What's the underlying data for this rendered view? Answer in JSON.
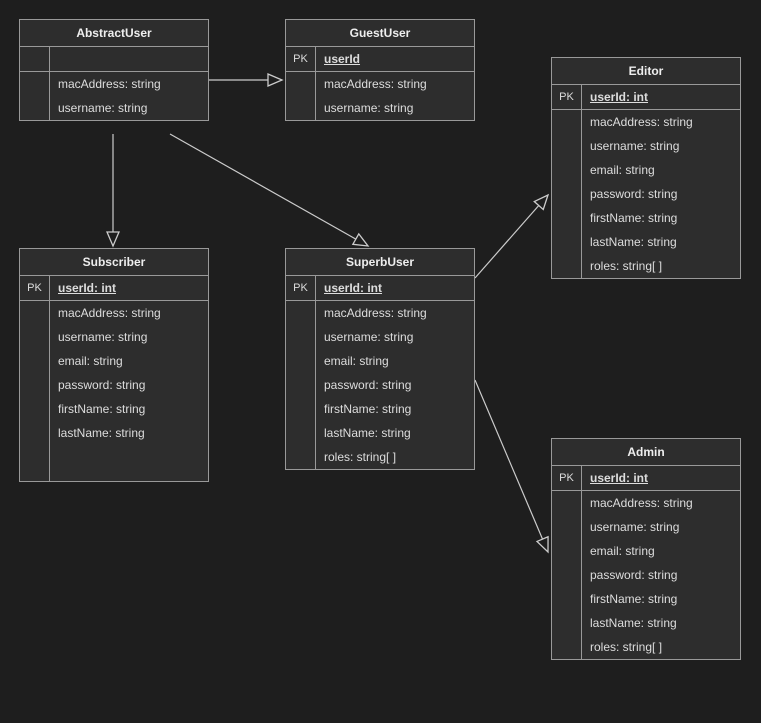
{
  "pk_label": "PK",
  "classes": {
    "abstractUser": {
      "title": "AbstractUser",
      "key": null,
      "attributes": [
        "macAddress: string",
        "username: string"
      ]
    },
    "guestUser": {
      "title": "GuestUser",
      "pk": "PK",
      "key": "userId",
      "attributes": [
        "macAddress: string",
        "username: string"
      ]
    },
    "subscriber": {
      "title": "Subscriber",
      "pk": "PK",
      "key": "userId: int",
      "attributes": [
        "macAddress: string",
        "username: string",
        "email: string",
        "password: string",
        "firstName: string",
        "lastName: string"
      ]
    },
    "superbUser": {
      "title": "SuperbUser",
      "pk": "PK",
      "key": "userId: int",
      "attributes": [
        "macAddress: string",
        "username: string",
        "email: string",
        "password: string",
        "firstName: string",
        "lastName: string",
        "roles: string[ ]"
      ]
    },
    "editor": {
      "title": "Editor",
      "pk": "PK",
      "key": "userId: int",
      "attributes": [
        "macAddress: string",
        "username: string",
        "email: string",
        "password: string",
        "firstName: string",
        "lastName: string",
        "roles: string[ ]"
      ]
    },
    "admin": {
      "title": "Admin",
      "pk": "PK",
      "key": "userId: int",
      "attributes": [
        "macAddress: string",
        "username: string",
        "email: string",
        "password: string",
        "firstName: string",
        "lastName: string",
        "roles: string[ ]"
      ]
    }
  },
  "relationships": [
    {
      "from": "GuestUser",
      "to": "AbstractUser",
      "type": "inheritance"
    },
    {
      "from": "Subscriber",
      "to": "AbstractUser",
      "type": "inheritance"
    },
    {
      "from": "SuperbUser",
      "to": "AbstractUser",
      "type": "inheritance"
    },
    {
      "from": "Editor",
      "to": "SuperbUser",
      "type": "inheritance"
    },
    {
      "from": "Admin",
      "to": "SuperbUser",
      "type": "inheritance"
    }
  ]
}
